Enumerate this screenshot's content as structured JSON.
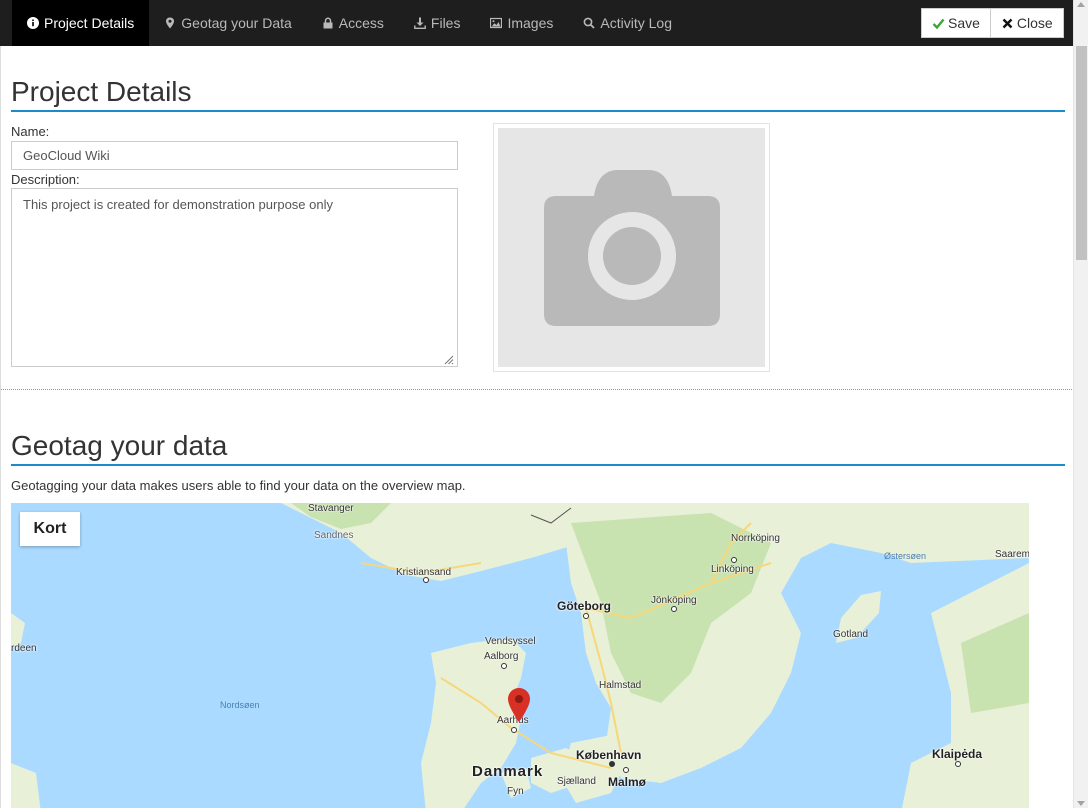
{
  "nav": {
    "tabs": [
      {
        "label": "Project Details",
        "icon": "info-icon",
        "active": true
      },
      {
        "label": "Geotag your Data",
        "icon": "map-pin-icon"
      },
      {
        "label": "Access",
        "icon": "lock-icon"
      },
      {
        "label": "Files",
        "icon": "download-icon"
      },
      {
        "label": "Images",
        "icon": "image-icon"
      },
      {
        "label": "Activity Log",
        "icon": "search-icon"
      }
    ],
    "save_label": "Save",
    "close_label": "Close"
  },
  "project": {
    "heading": "Project Details",
    "name_label": "Name:",
    "name_value": "GeoCloud Wiki",
    "description_label": "Description:",
    "description_value": "This project is created for demonstration purpose only",
    "image_placeholder_icon": "camera-icon"
  },
  "geotag": {
    "heading": "Geotag your data",
    "description": "Geotagging your data makes users able to find your data on the overview map.",
    "map_type_button": "Kort",
    "places": {
      "stavanger": "Stavanger",
      "sandnes": "Sandnes",
      "kristiansand": "Kristiansand",
      "goteborg": "Göteborg",
      "jonkoping": "Jönköping",
      "norrkoping": "Norrköping",
      "linkoping": "Linköping",
      "ostersoen": "Østersøen",
      "saarem": "Saarem",
      "gotland": "Gotland",
      "rdeen": "rdeen",
      "vendsyssel": "Vendsyssel",
      "aalborg": "Aalborg",
      "nordsoen": "Nordsøen",
      "halmstad": "Halmstad",
      "aarhus": "Aarhus",
      "kobenhavn": "København",
      "klaipeda": "Klaipėda",
      "danmark": "Danmark",
      "sjaelland": "Sjælland",
      "malmo": "Malmø",
      "fyn": "Fyn"
    },
    "colors": {
      "water": "#aadaff",
      "land": "#e8f0d8",
      "forest": "#c8e2b0",
      "road": "#f7d77a",
      "marker": "#d93025"
    }
  }
}
